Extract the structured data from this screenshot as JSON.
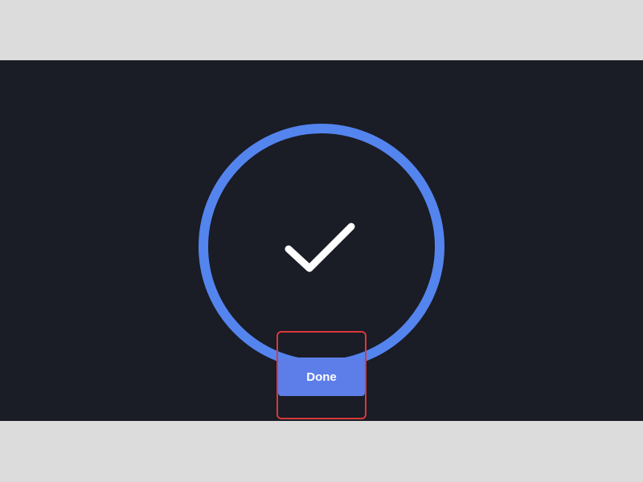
{
  "done_button": {
    "label": "Done"
  },
  "icons": {
    "status": "checkmark-icon"
  },
  "colors": {
    "background": "#1a1c26",
    "ring": "#5484ee",
    "button": "#5d7ee8",
    "button_text": "#ffffff",
    "checkmark": "#ffffff",
    "highlight": "#d9393c",
    "letterbox": "#dcdcdc"
  }
}
